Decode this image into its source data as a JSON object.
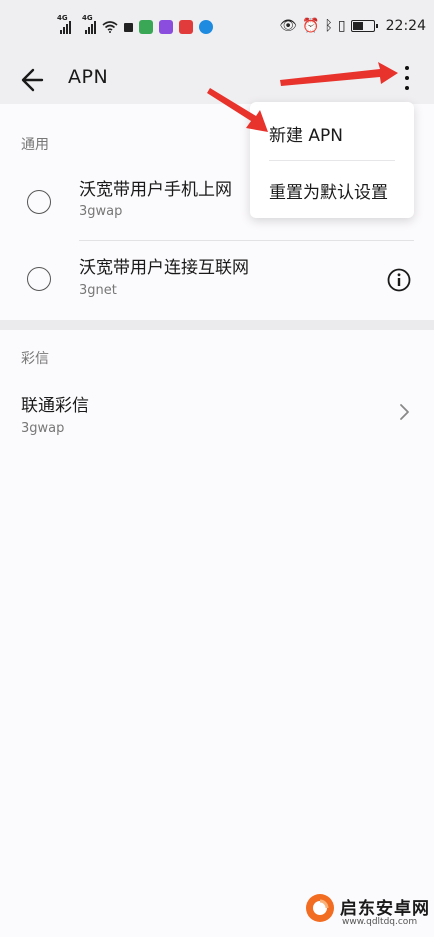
{
  "status_bar": {
    "network_left": "4G",
    "network_right": "4G",
    "time": "22:24",
    "colors": {
      "app1": "#3aa757",
      "app2": "#f7c900",
      "app3": "#8a4dde",
      "app4": "#e23b3b",
      "app5": "#1e8be0"
    }
  },
  "toolbar": {
    "back_icon": "arrow-left-icon",
    "title": "APN",
    "more_icon": "more-vertical-icon"
  },
  "sections": [
    {
      "header": "通用",
      "items": [
        {
          "title": "沃宽带用户手机上网",
          "subtitle": "3gwap",
          "selected": false
        },
        {
          "title": "沃宽带用户连接互联网",
          "subtitle": "3gnet",
          "selected": false,
          "info_icon": "info-circle-icon"
        }
      ]
    },
    {
      "header": "彩信",
      "items": [
        {
          "title": "联通彩信",
          "subtitle": "3gwap",
          "chevron_icon": "chevron-right-icon"
        }
      ]
    }
  ],
  "overflow_menu": {
    "items": [
      "新建 APN",
      "重置为默认设置"
    ]
  },
  "annotation": {
    "arrow_color": "#e8322c"
  },
  "watermark": {
    "name": "启东安卓网",
    "url": "www.qdltdq.com",
    "accent": "#f26d21"
  }
}
